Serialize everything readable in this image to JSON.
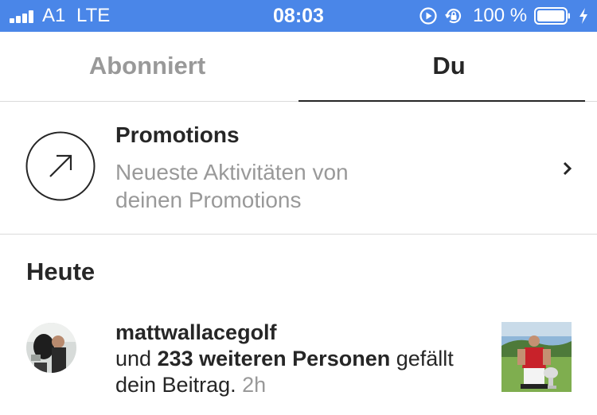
{
  "status_bar": {
    "carrier": "A1",
    "network": "LTE",
    "time": "08:03",
    "battery_percent": "100 %",
    "background": "#4a86e8",
    "icons": [
      "signal-bars-icon",
      "play-circle-icon",
      "rotation-lock-icon",
      "battery-icon",
      "charging-bolt-icon"
    ]
  },
  "tabs": [
    {
      "label": "Abonniert",
      "selected": false
    },
    {
      "label": "Du",
      "selected": true
    }
  ],
  "promotions": {
    "icon": "arrow-up-right-icon",
    "title": "Promotions",
    "subtitle_line1": "Neueste Aktivitäten von",
    "subtitle_line2": "deinen Promotions",
    "chevron": "chevron-right-icon"
  },
  "section": {
    "title": "Heute"
  },
  "activity": {
    "username": "mattwallacegolf",
    "text_prefix": "und ",
    "bold_count": "233 weiteren Personen",
    "text_suffix": " gefällt",
    "text_end": "dein Beitrag.",
    "time": "2h"
  },
  "colors": {
    "text": "#262626",
    "secondary": "#999999",
    "divider": "#dbdbdb"
  }
}
